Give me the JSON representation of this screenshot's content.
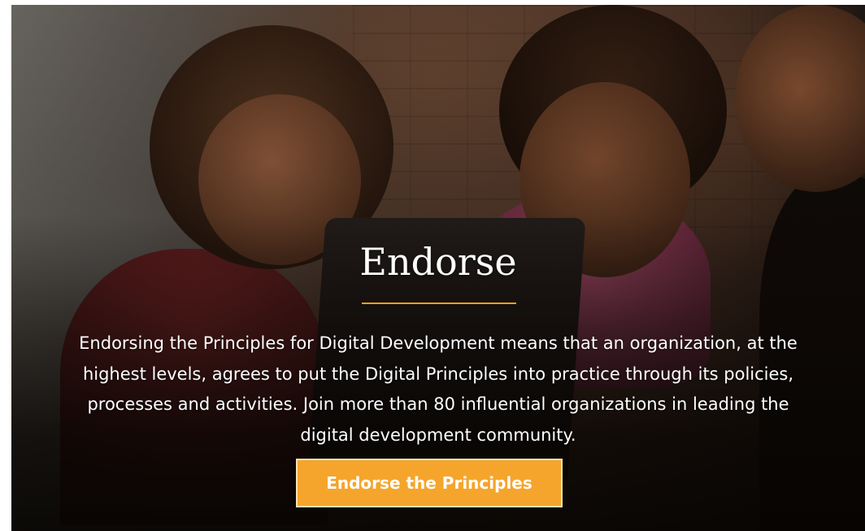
{
  "hero": {
    "heading": "Endorse",
    "body": "Endorsing the Principles for Digital Development means that an organization, at the highest levels, agrees to put the Digital Principles into practice through its policies, processes and activities. Join more than 80 influential organizations in leading the digital development community.",
    "cta_label": "Endorse the Principles",
    "accent_color": "#f5a52b"
  }
}
